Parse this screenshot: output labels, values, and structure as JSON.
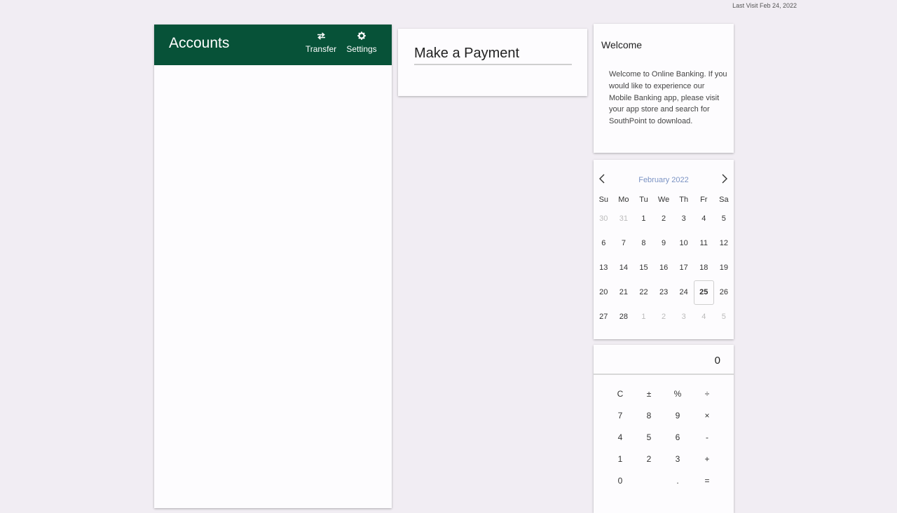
{
  "header": {
    "last_visit": "Last Visit Feb 24, 2022"
  },
  "accounts": {
    "title": "Accounts",
    "transfer_label": "Transfer",
    "settings_label": "Settings",
    "brand_color": "#075238"
  },
  "payment": {
    "title": "Make a Payment"
  },
  "welcome": {
    "title": "Welcome",
    "message": "Welcome to Online Banking. If you would like to experience our Mobile Banking app, please visit your app store and search for SouthPoint to download."
  },
  "calendar": {
    "month_label": "February 2022",
    "weekdays": [
      "Su",
      "Mo",
      "Tu",
      "We",
      "Th",
      "Fr",
      "Sa"
    ],
    "days": [
      {
        "label": "30",
        "muted": true
      },
      {
        "label": "31",
        "muted": true
      },
      {
        "label": "1"
      },
      {
        "label": "2"
      },
      {
        "label": "3"
      },
      {
        "label": "4"
      },
      {
        "label": "5"
      },
      {
        "label": "6"
      },
      {
        "label": "7"
      },
      {
        "label": "8"
      },
      {
        "label": "9"
      },
      {
        "label": "10"
      },
      {
        "label": "11"
      },
      {
        "label": "12"
      },
      {
        "label": "13"
      },
      {
        "label": "14"
      },
      {
        "label": "15"
      },
      {
        "label": "16"
      },
      {
        "label": "17"
      },
      {
        "label": "18"
      },
      {
        "label": "19"
      },
      {
        "label": "20"
      },
      {
        "label": "21"
      },
      {
        "label": "22"
      },
      {
        "label": "23"
      },
      {
        "label": "24"
      },
      {
        "label": "25",
        "today": true
      },
      {
        "label": "26"
      },
      {
        "label": "27"
      },
      {
        "label": "28"
      },
      {
        "label": "1",
        "muted": true
      },
      {
        "label": "2",
        "muted": true
      },
      {
        "label": "3",
        "muted": true
      },
      {
        "label": "4",
        "muted": true
      },
      {
        "label": "5",
        "muted": true
      }
    ]
  },
  "calculator": {
    "display": "0",
    "rows": [
      [
        "C",
        "±",
        "%",
        "÷"
      ],
      [
        "7",
        "8",
        "9",
        "×"
      ],
      [
        "4",
        "5",
        "6",
        "-"
      ],
      [
        "1",
        "2",
        "3",
        "+"
      ],
      [
        "0",
        "",
        ".",
        "="
      ]
    ]
  }
}
